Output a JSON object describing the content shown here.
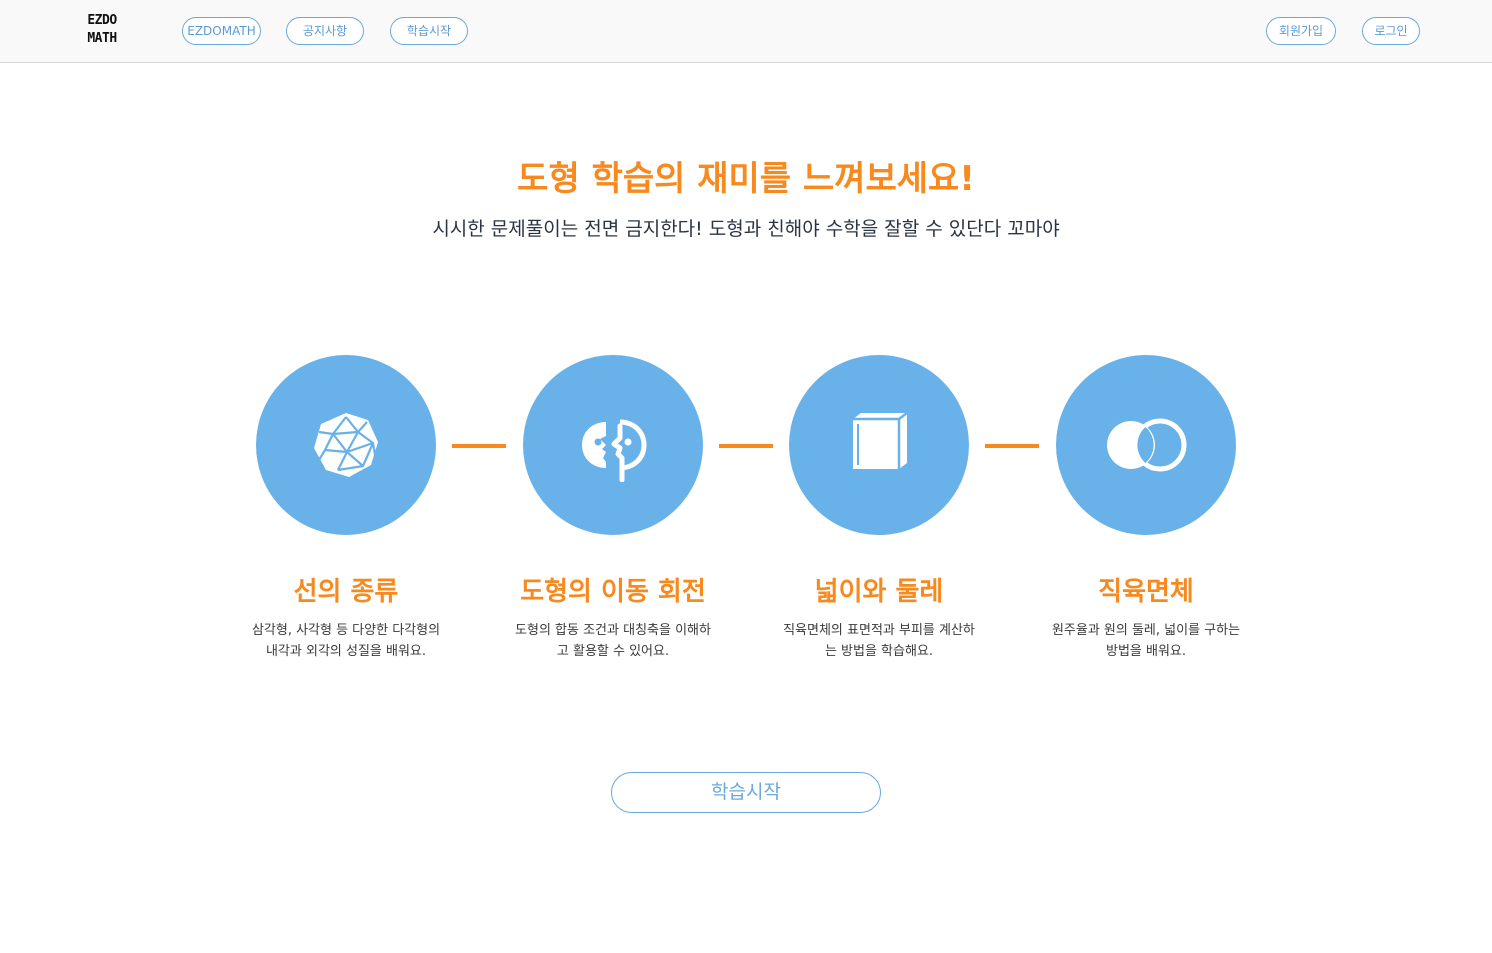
{
  "header": {
    "logo_line1": "EZDO",
    "logo_line2": "MATH",
    "nav": {
      "home": "EZDOMATH",
      "notice": "공지사항",
      "start": "학습시작"
    },
    "auth": {
      "signup": "회원가입",
      "login": "로그인"
    }
  },
  "hero": {
    "title": "도형 학습의 재미를 느껴보세요!",
    "subtitle": "시시한 문제풀이는 전면 금지한다! 도형과 친해야 수학을 잘할 수 있단다 꼬마야"
  },
  "features": [
    {
      "icon": "polyhedron-icon",
      "title": "선의 종류",
      "desc_line1": "삼각형, 사각형 등 다양한 다각형의",
      "desc_line2": "내각과 외각의 성질을 배워요."
    },
    {
      "icon": "mirrored-faces-icon",
      "title": "도형의 이동 회전",
      "desc_line1": "도형의 합동 조건과 대칭축을 이해하",
      "desc_line2": "고 활용할 수 있어요."
    },
    {
      "icon": "cube-icon",
      "title": "넓이와 둘레",
      "desc_line1": "직육면체의 표면적과 부피를 계산하",
      "desc_line2": "는 방법을 학습해요."
    },
    {
      "icon": "overlapping-circles-icon",
      "title": "직육면체",
      "desc_line1": "원주율과 원의 둘레, 넓이를 구하는",
      "desc_line2": "방법을 배워요."
    }
  ],
  "cta": {
    "label": "학습시작"
  },
  "colors": {
    "accent_orange": "#f7891e",
    "circle_blue": "#69b1e9",
    "outline_blue": "#6aa9dc",
    "header_bg": "#f9f9f9"
  }
}
